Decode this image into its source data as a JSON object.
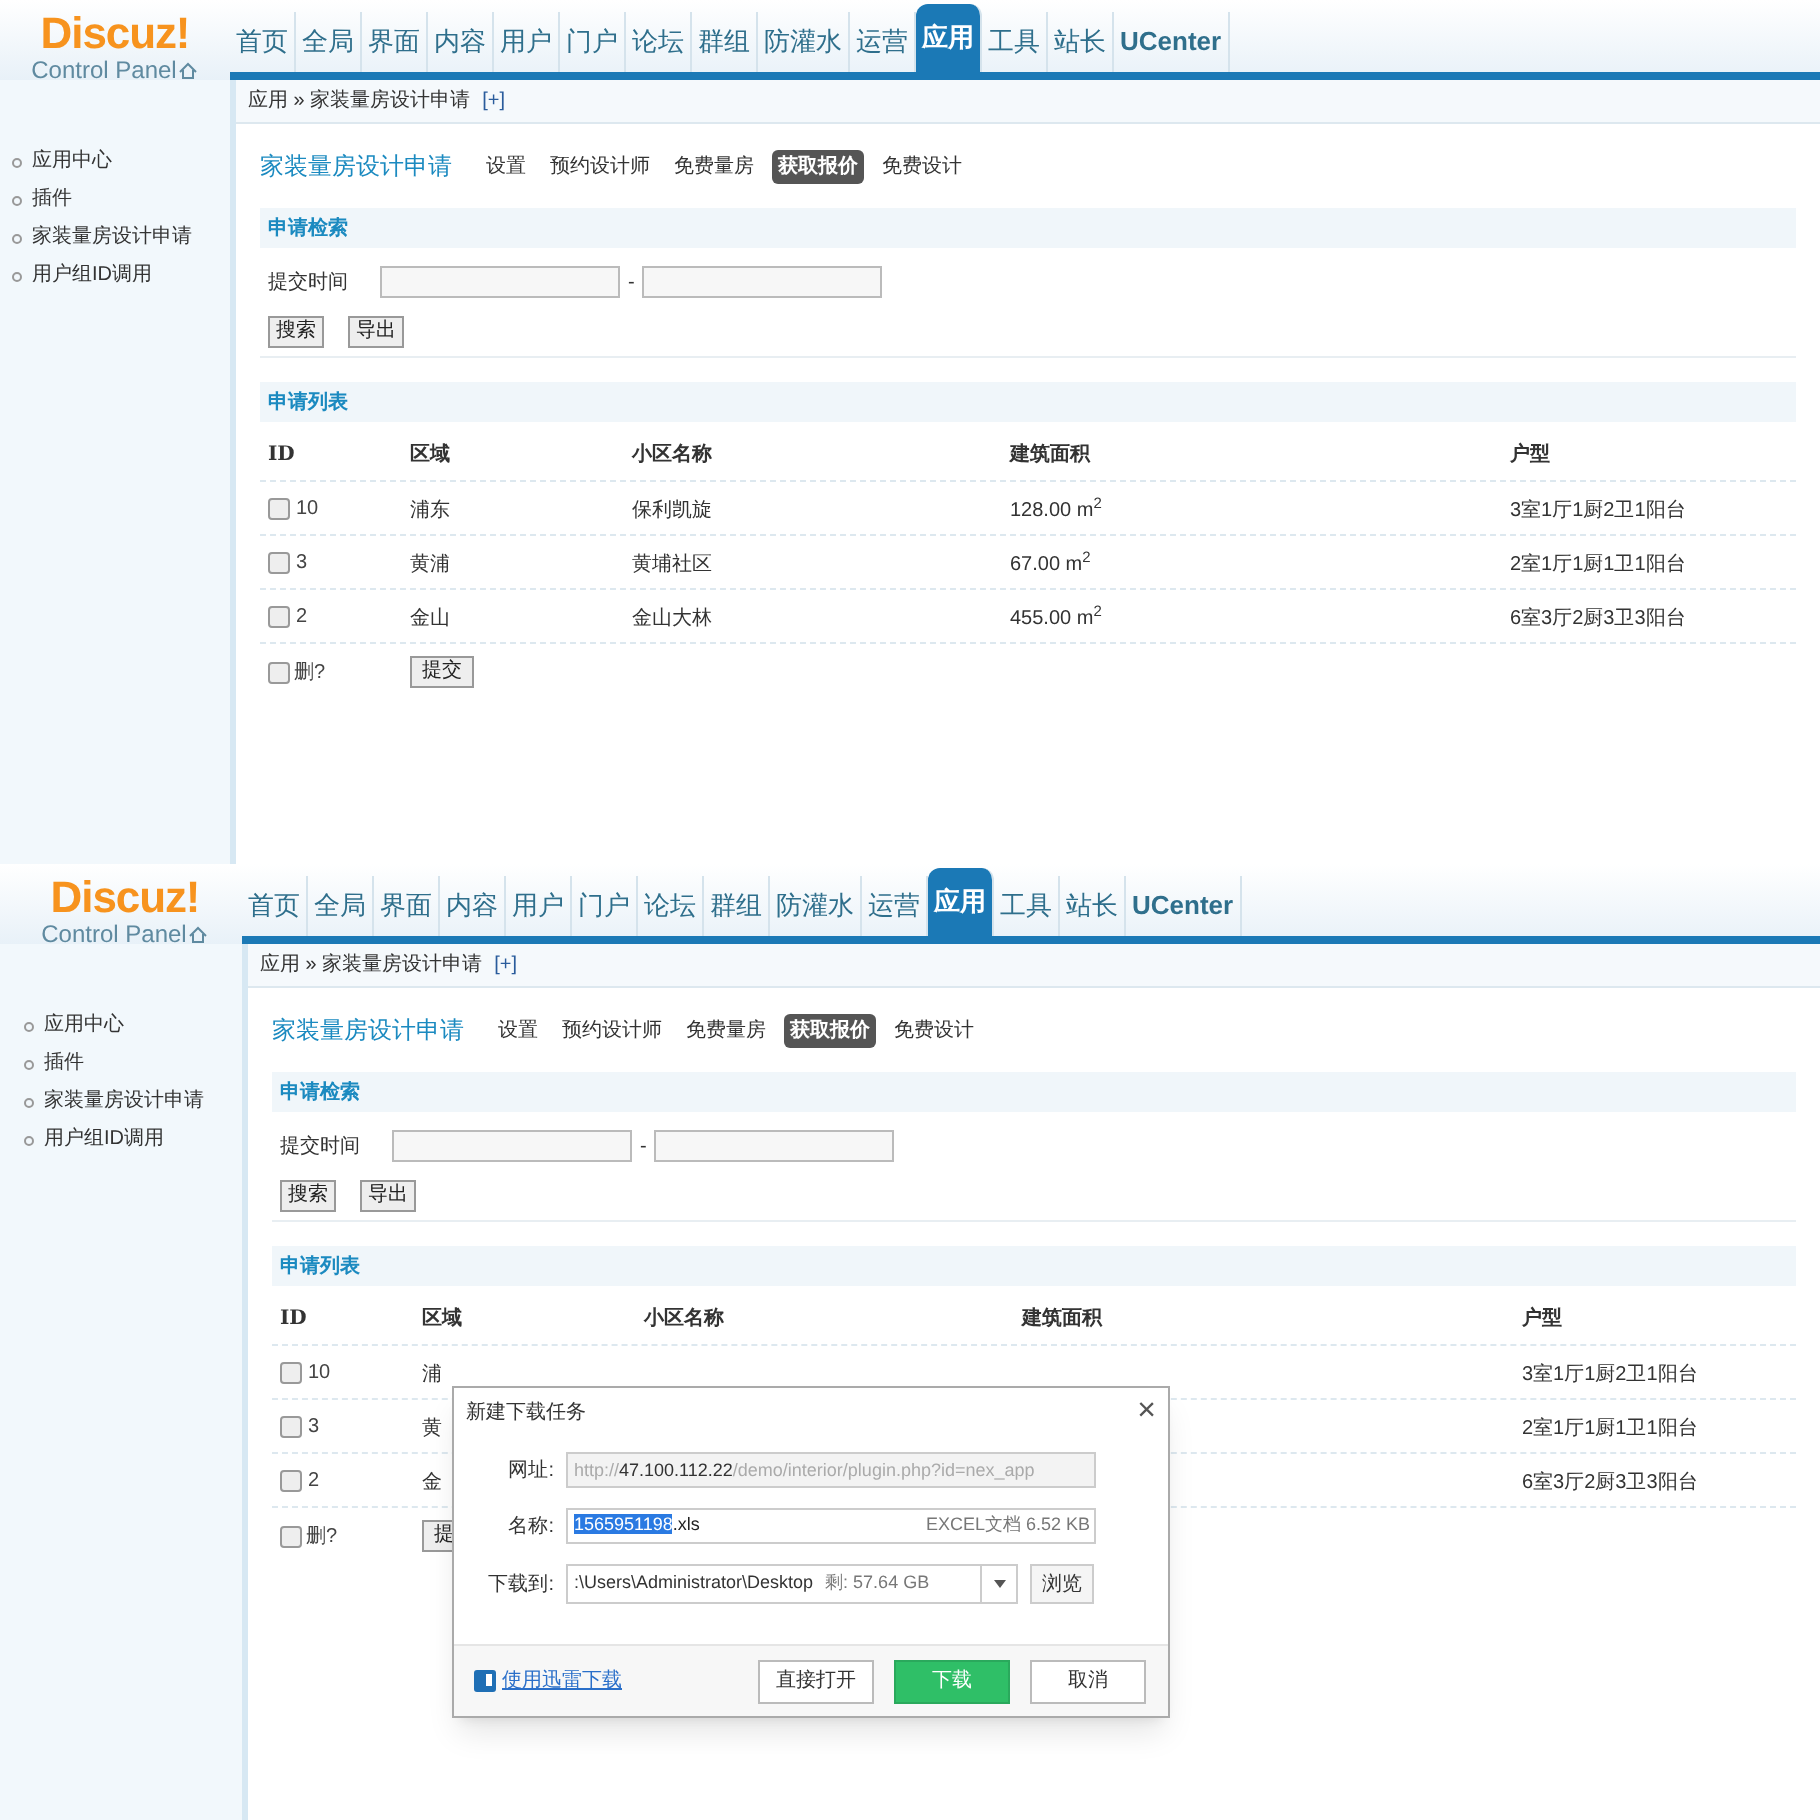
{
  "screens": [
    {
      "logo": {
        "title": "Discuz!",
        "subtitle": "Control Panel"
      },
      "nav": [
        {
          "label": "首页",
          "selected": false
        },
        {
          "label": "全局",
          "selected": false
        },
        {
          "label": "界面",
          "selected": false
        },
        {
          "label": "内容",
          "selected": false
        },
        {
          "label": "用户",
          "selected": false
        },
        {
          "label": "门户",
          "selected": false
        },
        {
          "label": "论坛",
          "selected": false
        },
        {
          "label": "群组",
          "selected": false
        },
        {
          "label": "防灌水",
          "selected": false
        },
        {
          "label": "运营",
          "selected": false
        },
        {
          "label": "应用",
          "selected": true
        },
        {
          "label": "工具",
          "selected": false
        },
        {
          "label": "站长",
          "selected": false
        },
        {
          "label": "UCenter",
          "selected": false
        }
      ],
      "breadcrumb": {
        "path": "应用 » 家装量房设计申请",
        "add": "[+]"
      },
      "sidebar": {
        "items": [
          "应用中心",
          "插件",
          "家装量房设计申请",
          "用户组ID调用"
        ]
      },
      "plugin_title": "家装量房设计申请",
      "plugin_tabs": [
        {
          "label": "设置",
          "selected": false
        },
        {
          "label": "预约设计师",
          "selected": false
        },
        {
          "label": "免费量房",
          "selected": false
        },
        {
          "label": "获取报价",
          "selected": true
        },
        {
          "label": "免费设计",
          "selected": false
        }
      ],
      "search_section": {
        "title": "申请检索",
        "label": "提交时间",
        "separator": "-",
        "buttons": [
          "搜索",
          "导出"
        ]
      },
      "list_section": {
        "title": "申请列表",
        "columns": [
          "ID",
          "区域",
          "小区名称",
          "建筑面积",
          "户型"
        ],
        "rows": [
          {
            "id": "10",
            "checked": false,
            "area": "浦东",
            "community": "保利凯旋",
            "floor_area": "128.00 m$^{2}$",
            "layout": "3室1厅1厨2卫1阳台"
          },
          {
            "id": "3",
            "checked": false,
            "area": "黄浦",
            "community": "黄埔社区",
            "floor_area": "67.00 m$^{2}$",
            "layout": "2室1厅1厨1卫1阳台"
          },
          {
            "id": "2",
            "checked": false,
            "area": "金山",
            "community": "金山大林",
            "floor_area": "455.00 m$^{2}$",
            "layout": "6室3厅2厨3卫3阳台"
          }
        ],
        "delete_label": "删?",
        "delete_checked": false,
        "submit": "提交"
      }
    },
    {
      "logo": {
        "title": "Discuz!",
        "subtitle": "Control Panel"
      },
      "nav": [
        {
          "label": "首页",
          "selected": false
        },
        {
          "label": "全局",
          "selected": false
        },
        {
          "label": "界面",
          "selected": false
        },
        {
          "label": "内容",
          "selected": false
        },
        {
          "label": "用户",
          "selected": false
        },
        {
          "label": "门户",
          "selected": false
        },
        {
          "label": "论坛",
          "selected": false
        },
        {
          "label": "群组",
          "selected": false
        },
        {
          "label": "防灌水",
          "selected": false
        },
        {
          "label": "运营",
          "selected": false
        },
        {
          "label": "应用",
          "selected": true
        },
        {
          "label": "工具",
          "selected": false
        },
        {
          "label": "站长",
          "selected": false
        },
        {
          "label": "UCenter",
          "selected": false
        }
      ],
      "breadcrumb": {
        "path": "应用 » 家装量房设计申请",
        "add": "[+]"
      },
      "sidebar": {
        "items": [
          "应用中心",
          "插件",
          "家装量房设计申请",
          "用户组ID调用"
        ]
      },
      "plugin_title": "家装量房设计申请",
      "plugin_tabs": [
        {
          "label": "设置",
          "selected": false
        },
        {
          "label": "预约设计师",
          "selected": false
        },
        {
          "label": "免费量房",
          "selected": false
        },
        {
          "label": "获取报价",
          "selected": true
        },
        {
          "label": "免费设计",
          "selected": false
        }
      ],
      "search_section": {
        "title": "申请检索",
        "label": "提交时间",
        "separator": "-",
        "buttons": [
          "搜索",
          "导出"
        ]
      },
      "list_section": {
        "title": "申请列表",
        "columns": [
          "ID",
          "区域",
          "小区名称",
          "建筑面积",
          "户型"
        ],
        "rows": [
          {
            "id": "10",
            "checked": false,
            "area": "浦",
            "layout": "3室1厅1厨2卫1阳台"
          },
          {
            "id": "3",
            "checked": false,
            "area": "黄",
            "layout": "2室1厅1厨1卫1阳台"
          },
          {
            "id": "2",
            "checked": false,
            "area": "金",
            "layout": "6室3厅2厨3卫3阳台"
          }
        ],
        "delete_label": "删?",
        "delete_checked": false,
        "submit": "提"
      },
      "download_dialog": {
        "title": "新建下载任务",
        "close": "×",
        "url_label": "网址:",
        "url": "http://**47.100.112.22**/demo/interior/plugin.php?id=nex_app",
        "name_label": "名称:",
        "name_selected": "1565951198",
        "name_rest": ".xls",
        "file_info": "EXCEL文档 6.52 KB",
        "dest_label": "下载到:",
        "dest": ":\\Users\\Administrator\\Desktop",
        "free_space": "剩: 57.64 GB",
        "browse": "浏览",
        "thunder_link": "使用迅雷下载",
        "buttons": [
          {
            "label": "直接打开",
            "kind": "normal"
          },
          {
            "label": "下载",
            "kind": "primary"
          },
          {
            "label": "取消",
            "kind": "normal"
          }
        ]
      }
    }
  ]
}
